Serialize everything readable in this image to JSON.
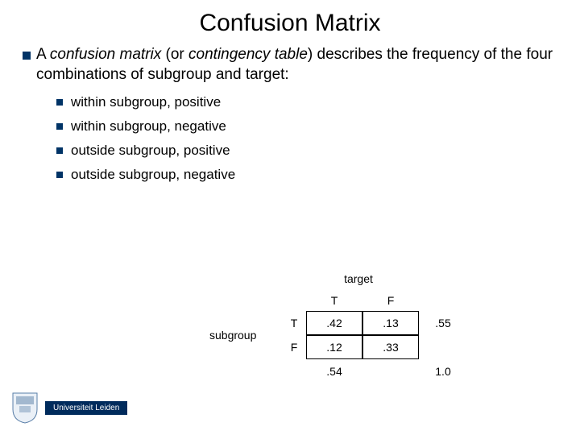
{
  "title": "Confusion Matrix",
  "intro": {
    "pre": "A ",
    "term1": "confusion matrix",
    "mid": " (or ",
    "term2": "contingency table",
    "post": ") describes the frequency of the four combinations of subgroup and target:"
  },
  "bullets": [
    "within subgroup, positive",
    "within subgroup, negative",
    "outside subgroup, positive",
    "outside subgroup, negative"
  ],
  "table": {
    "targetLabel": "target",
    "subgroupLabel": "subgroup",
    "colT": "T",
    "colF": "F",
    "rowT": "T",
    "rowF": "F",
    "cells": {
      "tt": ".42",
      "tf": ".13",
      "ft": ".12",
      "ff": ".33"
    },
    "marginals": {
      "row1": ".55",
      "col1": ".54",
      "total": "1.0"
    }
  },
  "footer": {
    "university": "Universiteit Leiden"
  },
  "chart_data": {
    "type": "table",
    "title": "Confusion Matrix",
    "row_dimension": "subgroup",
    "col_dimension": "target",
    "categories_rows": [
      "T",
      "F"
    ],
    "categories_cols": [
      "T",
      "F"
    ],
    "values": [
      [
        0.42,
        0.13
      ],
      [
        0.12,
        0.33
      ]
    ],
    "row_marginals": [
      0.55
    ],
    "col_marginals": [
      0.54
    ],
    "grand_total": 1.0
  }
}
